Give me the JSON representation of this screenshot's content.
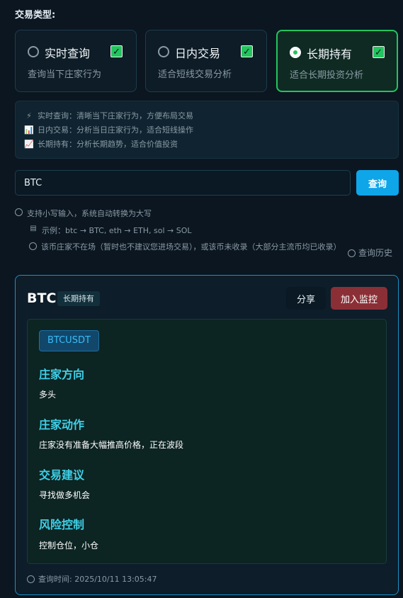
{
  "section_label": "交易类型:",
  "trade_types": [
    {
      "title": "实时查询",
      "desc": "查询当下庄家行为",
      "selected": false
    },
    {
      "title": "日内交易",
      "desc": "适合短线交易分析",
      "selected": false
    },
    {
      "title": "长期持有",
      "desc": "适合长期投资分析",
      "selected": true
    }
  ],
  "info_lines": [
    {
      "icon": "⚡",
      "text": "实时查询：清晰当下庄家行为，方便布局交易"
    },
    {
      "icon": "📊",
      "text": "日内交易：分析当日庄家行为，适合短线操作"
    },
    {
      "icon": "📈",
      "text": "长期持有：分析长期趋势，适合价值投资"
    }
  ],
  "search": {
    "value": "BTC",
    "button_label": "查询"
  },
  "hints": {
    "lowercase": "支持小写输入，系统自动转换为大写",
    "example": "示例：btc → BTC, eth → ETH, sol → SOL",
    "warning": "该币庄家不在场（暂时也不建议您进场交易），或该币未收录（大部分主流币均已收录）",
    "history_label": "查询历史"
  },
  "result": {
    "symbol": "BTC",
    "tag": "长期持有",
    "share_label": "分享",
    "monitor_label": "加入监控",
    "pair": "BTCUSDT",
    "fields": [
      {
        "label": "庄家方向",
        "value": "多头"
      },
      {
        "label": "庄家动作",
        "value": "庄家没有准备大幅推高价格，正在波段"
      },
      {
        "label": "交易建议",
        "value": "寻找做多机会"
      },
      {
        "label": "风险控制",
        "value": "控制仓位，小仓"
      }
    ],
    "query_time": "查询时间: 2025/10/11 13:05:47"
  },
  "colors": {
    "accent_green": "#22c55e",
    "accent_blue": "#0ea5e9",
    "monitor_red": "#8b2f36",
    "field_label": "#3fd0e8"
  }
}
